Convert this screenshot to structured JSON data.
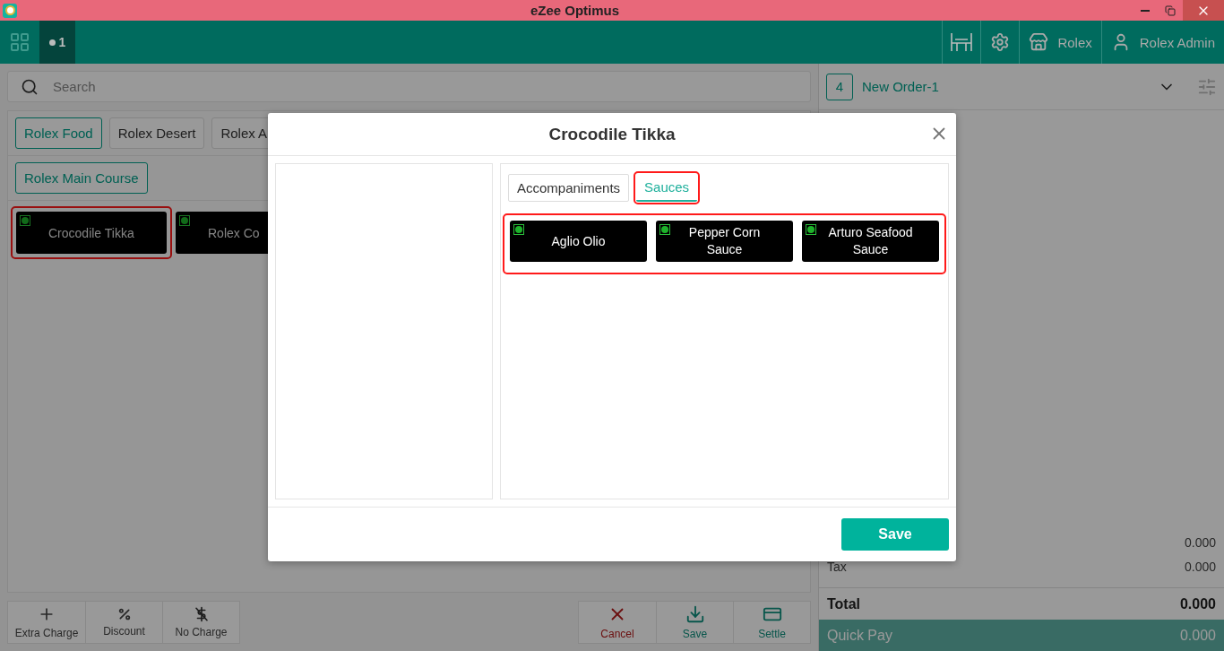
{
  "window": {
    "title": "eZee Optimus"
  },
  "header": {
    "tabs": [
      {
        "label": "1",
        "selected": true
      }
    ],
    "store": "Rolex",
    "user": "Rolex Admin"
  },
  "search": {
    "placeholder": "Search"
  },
  "categories": [
    {
      "label": "Rolex Food",
      "selected": true
    },
    {
      "label": "Rolex Desert",
      "selected": false
    },
    {
      "label": "Rolex A",
      "selected": false
    }
  ],
  "subcategories": [
    {
      "label": "Rolex Main Course",
      "selected": true
    }
  ],
  "items": [
    {
      "name": "Crocodile Tikka",
      "highlighted": true
    },
    {
      "name": "Rolex Co",
      "highlighted": false
    }
  ],
  "left_actions": [
    {
      "label": "Extra Charge",
      "kind": "plus"
    },
    {
      "label": "Discount",
      "kind": "percent"
    },
    {
      "label": "No Charge",
      "kind": "nocharge"
    }
  ],
  "right_actions": [
    {
      "label": "Cancel",
      "kind": "cancel"
    },
    {
      "label": "Save",
      "kind": "save"
    },
    {
      "label": "Settle",
      "kind": "settle"
    }
  ],
  "order": {
    "count": "4",
    "name": "New Order-1"
  },
  "summary": [
    {
      "value": "0.000"
    },
    {
      "label": "Tax",
      "value": "0.000"
    }
  ],
  "total": {
    "label": "Total",
    "value": "0.000"
  },
  "quick_pay": {
    "label": "Quick Pay",
    "value": "0.000"
  },
  "modal": {
    "title": "Crocodile Tikka",
    "tabs": [
      {
        "label": "Accompaniments",
        "selected": false,
        "highlighted": false
      },
      {
        "label": "Sauces",
        "selected": true,
        "highlighted": true
      }
    ],
    "options_highlighted": true,
    "options": [
      {
        "name": "Aglio Olio"
      },
      {
        "name": "Pepper Corn Sauce"
      },
      {
        "name": "Arturo Seafood Sauce"
      }
    ],
    "save": "Save"
  }
}
